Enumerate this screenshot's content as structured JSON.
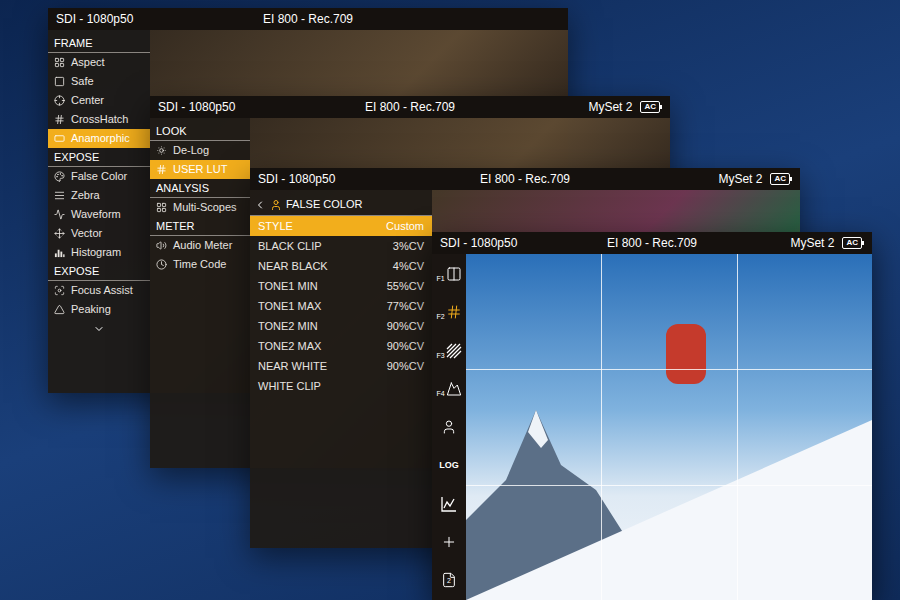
{
  "layers": [
    {
      "header": {
        "input": "SDI - 1080p50",
        "exposure": "EI 800 - Rec.709"
      },
      "menu": [
        {
          "kind": "section",
          "label": "FRAME",
          "selected": false
        },
        {
          "kind": "item",
          "label": "Aspect",
          "selected": false
        },
        {
          "kind": "item",
          "label": "Safe",
          "selected": false
        },
        {
          "kind": "item",
          "label": "Center",
          "selected": false
        },
        {
          "kind": "item",
          "label": "CrossHatch",
          "selected": false
        },
        {
          "kind": "item",
          "label": "Anamorphic",
          "selected": true
        },
        {
          "kind": "section",
          "label": "EXPOSE",
          "selected": false
        },
        {
          "kind": "item",
          "label": "False Color",
          "selected": false
        },
        {
          "kind": "item",
          "label": "Zebra",
          "selected": false
        },
        {
          "kind": "item",
          "label": "Waveform",
          "selected": false
        },
        {
          "kind": "item",
          "label": "Vector",
          "selected": false
        },
        {
          "kind": "item",
          "label": "Histogram",
          "selected": false
        },
        {
          "kind": "section",
          "label": "EXPOSE",
          "selected": false
        },
        {
          "kind": "item",
          "label": "Focus Assist",
          "selected": false
        },
        {
          "kind": "item",
          "label": "Peaking",
          "selected": false
        }
      ]
    },
    {
      "header": {
        "input": "SDI - 1080p50",
        "exposure": "EI 800 - Rec.709",
        "preset": "MySet 2",
        "badge": "AC"
      },
      "menu": [
        {
          "kind": "section",
          "label": "LOOK",
          "selected": false
        },
        {
          "kind": "item",
          "label": "De-Log",
          "selected": false
        },
        {
          "kind": "item",
          "label": "USER LUT",
          "selected": true
        },
        {
          "kind": "section",
          "label": "ANALYSIS",
          "selected": false
        },
        {
          "kind": "item",
          "label": "Multi-Scopes",
          "selected": false
        },
        {
          "kind": "section",
          "label": "METER",
          "selected": false
        },
        {
          "kind": "item",
          "label": "Audio Meter",
          "selected": false
        },
        {
          "kind": "item",
          "label": "Time Code",
          "selected": false
        }
      ]
    },
    {
      "header": {
        "input": "SDI - 1080p50",
        "exposure": "EI 800 - Rec.709",
        "preset": "MySet 2",
        "badge": "AC"
      },
      "submenu": {
        "title": "FALSE COLOR",
        "rows": [
          {
            "label": "STYLE",
            "value": "Custom",
            "selected": true
          },
          {
            "label": "BLACK CLIP",
            "value": "3%CV",
            "selected": false
          },
          {
            "label": "NEAR BLACK",
            "value": "4%CV",
            "selected": false
          },
          {
            "label": "TONE1 MIN",
            "value": "55%CV",
            "selected": false
          },
          {
            "label": "TONE1 MAX",
            "value": "77%CV",
            "selected": false
          },
          {
            "label": "TONE2 MIN",
            "value": "90%CV",
            "selected": false
          },
          {
            "label": "TONE2 MAX",
            "value": "90%CV",
            "selected": false
          },
          {
            "label": "NEAR WHITE",
            "value": "90%CV",
            "selected": false
          },
          {
            "label": "WHITE CLIP",
            "selected": false
          }
        ]
      }
    },
    {
      "header": {
        "input": "SDI - 1080p50",
        "exposure": "EI 800 - Rec.709",
        "preset": "MySet 2",
        "badge": "AC"
      },
      "toolbar": [
        {
          "kind": "function",
          "label": "F1",
          "selected": false
        },
        {
          "kind": "function",
          "label": "F2",
          "selected": true
        },
        {
          "kind": "function",
          "label": "F3",
          "selected": false
        },
        {
          "kind": "function",
          "label": "F4",
          "selected": false
        },
        {
          "kind": "user",
          "selected": false
        },
        {
          "kind": "text",
          "label": "LOG",
          "selected": false
        },
        {
          "kind": "scopes",
          "selected": false
        },
        {
          "kind": "add",
          "selected": false
        },
        {
          "kind": "page",
          "label": "2",
          "selected": false
        }
      ]
    }
  ]
}
